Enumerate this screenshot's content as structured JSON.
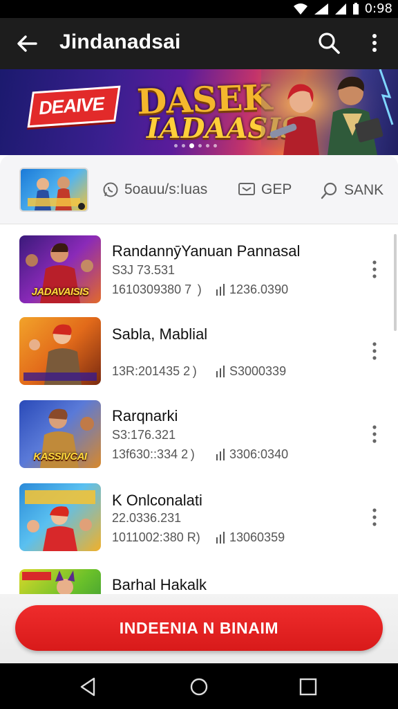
{
  "status_bar": {
    "time": "0:98"
  },
  "app_bar": {
    "title": "Jindanadsai"
  },
  "banner": {
    "flag_text": "DEAIVE",
    "logo_line1": "DASEK",
    "logo_line2": "IADAASIS"
  },
  "tabs": [
    {
      "label": "5oauu/s:Iuas",
      "icon": "whatsapp-icon"
    },
    {
      "label": "GEP",
      "icon": "message-icon"
    },
    {
      "label": "SANK",
      "icon": "search-icon"
    }
  ],
  "games": [
    {
      "title": "RandannȳYanuan Pannasal",
      "subtitle": "S3J 73.531",
      "meta1": "1610309380 7  )",
      "meta2": "1236.0390",
      "thumb_caption": "JADAVAISIS"
    },
    {
      "title": "Sabla, Mablial",
      "subtitle": "",
      "meta1": "13R:201435 2 )",
      "meta2": "S3000339",
      "thumb_caption": ""
    },
    {
      "title": "Rarqnarki",
      "subtitle": "S3:176.321",
      "meta1": "13f630::334 2 )",
      "meta2": "3306:0340",
      "thumb_caption": "KASSIVCAI"
    },
    {
      "title": "K Onlconalati",
      "subtitle": "22.0336.231",
      "meta1": "1011002:380 R)",
      "meta2": "13060359",
      "thumb_caption": ""
    },
    {
      "title": "Barhal Hakalk",
      "subtitle": "",
      "meta1": "",
      "meta2": "",
      "thumb_caption": ""
    }
  ],
  "cta": {
    "label": "INDEENIA N BINAIM"
  },
  "colors": {
    "accent": "#e02020",
    "appbar": "#1d1d1d"
  }
}
